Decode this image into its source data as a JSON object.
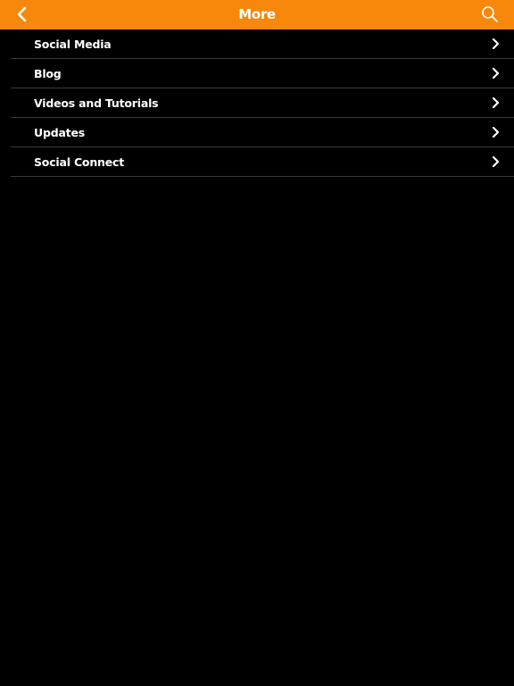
{
  "header": {
    "title": "More",
    "back_icon": "chevron-left-icon",
    "search_icon": "search-icon",
    "background_color": "#f7880c"
  },
  "menu": {
    "items": [
      {
        "label": "Social Media",
        "icon": "chevron-right-icon"
      },
      {
        "label": "Blog",
        "icon": "chevron-right-icon"
      },
      {
        "label": "Videos and Tutorials",
        "icon": "chevron-right-icon"
      },
      {
        "label": "Updates",
        "icon": "chevron-right-icon"
      },
      {
        "label": "Social Connect",
        "icon": "chevron-right-icon"
      }
    ]
  },
  "colors": {
    "background": "#000000",
    "text": "#ffffff",
    "divider": "#3a3a3a"
  }
}
